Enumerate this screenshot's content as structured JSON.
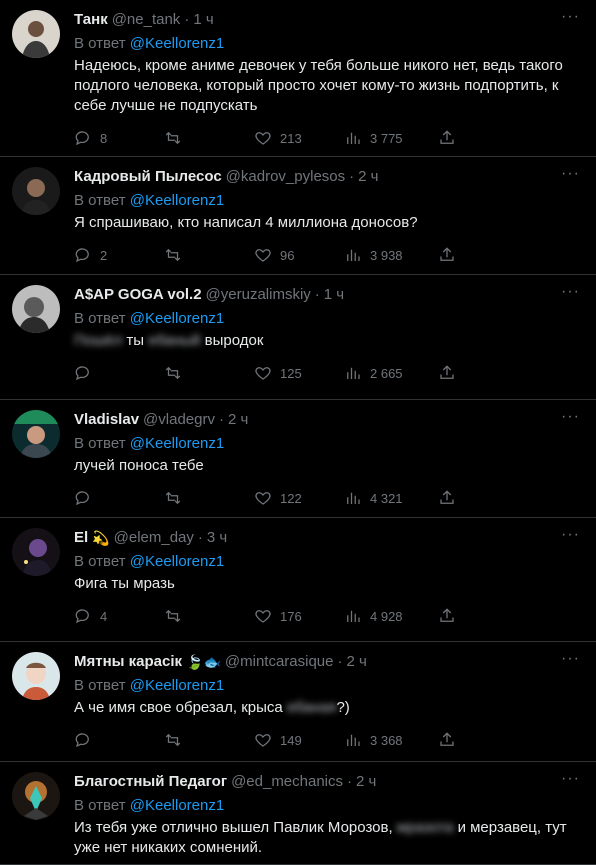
{
  "colors": {
    "accent": "#1d9bf0",
    "muted": "#71767b",
    "text": "#e7e9ea",
    "divider": "#2f3336"
  },
  "icons": {
    "reply": "speech-bubble-icon",
    "retweet": "retweet-arrows-icon",
    "like": "heart-icon",
    "views": "bar-chart-icon",
    "share": "share-upload-icon",
    "more": "ellipsis-icon"
  },
  "tweets": [
    {
      "name": "Танк",
      "handle": "@ne_tank",
      "time": "1 ч",
      "emoji": "",
      "reply_prefix": "В ответ",
      "reply_to": "@Keellorenz1",
      "segments": [
        {
          "t": "Надеюсь, кроме аниме девочек у тебя больше никого нет, ведь такого подлого человека, который просто хочет кому-то жизнь подпортить, к себе лучше не подпускать",
          "blur": false
        }
      ],
      "stats": {
        "replies": "8",
        "retweets": "",
        "likes": "213",
        "views": "3 775"
      }
    },
    {
      "name": "Кадровый Пылесос",
      "handle": "@kadrov_pylesos",
      "time": "2 ч",
      "emoji": "",
      "reply_prefix": "В ответ",
      "reply_to": "@Keellorenz1",
      "segments": [
        {
          "t": "Я спрашиваю, кто написал 4 миллиона доносов?",
          "blur": false
        }
      ],
      "stats": {
        "replies": "2",
        "retweets": "",
        "likes": "96",
        "views": "3 938"
      }
    },
    {
      "name": "A$AP GOGA vol.2",
      "handle": "@yeruzalimskiy",
      "time": "1 ч",
      "emoji": "",
      "reply_prefix": "В ответ",
      "reply_to": "@Keellorenz1",
      "segments": [
        {
          "t": "Пошёл",
          "blur": true
        },
        {
          "t": " ты ",
          "blur": false
        },
        {
          "t": "ебаный",
          "blur": true
        },
        {
          "t": " выродок",
          "blur": false
        }
      ],
      "stats": {
        "replies": "",
        "retweets": "",
        "likes": "125",
        "views": "2 665"
      }
    },
    {
      "name": "Vladislav",
      "handle": "@vladegrv",
      "time": "2 ч",
      "emoji": "",
      "reply_prefix": "В ответ",
      "reply_to": "@Keellorenz1",
      "segments": [
        {
          "t": "лучей поноса тебе",
          "blur": false
        }
      ],
      "stats": {
        "replies": "",
        "retweets": "",
        "likes": "122",
        "views": "4 321"
      }
    },
    {
      "name": "El",
      "handle": "@elem_day",
      "time": "3 ч",
      "emoji": "💫",
      "reply_prefix": "В ответ",
      "reply_to": "@Keellorenz1",
      "segments": [
        {
          "t": "Фига ты мразь",
          "blur": false
        }
      ],
      "stats": {
        "replies": "4",
        "retweets": "",
        "likes": "176",
        "views": "4 928"
      }
    },
    {
      "name": "Мятны карасік",
      "handle": "@mintcarasique",
      "time": "2 ч",
      "emoji": "🍃🐟",
      "reply_prefix": "В ответ",
      "reply_to": "@Keellorenz1",
      "segments": [
        {
          "t": "А че имя свое обрезал, крыса ",
          "blur": false
        },
        {
          "t": "ебаная",
          "blur": true
        },
        {
          "t": "?)",
          "blur": false
        }
      ],
      "stats": {
        "replies": "",
        "retweets": "",
        "likes": "149",
        "views": "3 368"
      }
    },
    {
      "name": "Благостный Педагог",
      "handle": "@ed_mechanics",
      "time": "2 ч",
      "emoji": "",
      "reply_prefix": "В ответ",
      "reply_to": "@Keellorenz1",
      "segments": [
        {
          "t": "Из тебя уже отлично вышел Павлик Морозов, ",
          "blur": false
        },
        {
          "t": "мразота",
          "blur": true
        },
        {
          "t": " и мерзавец, тут уже нет никаких сомнений.",
          "blur": false
        }
      ],
      "stats": {
        "replies": "",
        "retweets": "",
        "likes": "",
        "views": ""
      }
    }
  ]
}
